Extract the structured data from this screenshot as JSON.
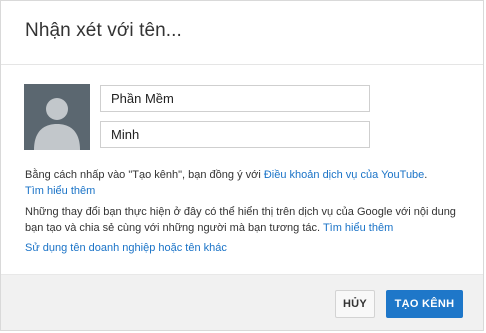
{
  "dialog": {
    "title": "Nhận xét với tên..."
  },
  "form": {
    "first_name": {
      "value": "Phần Mềm"
    },
    "last_name": {
      "value": "Minh"
    }
  },
  "tos": {
    "text": "Bằng cách nhấp vào \"Tạo kênh\", bạn đồng ý với ",
    "terms_link": "Điều khoản dịch vụ của YouTube",
    "period": ".",
    "learn_more": "Tìm hiểu thêm"
  },
  "notice": {
    "text": "Những thay đổi bạn thực hiện ở đây có thể hiển thị trên dịch vụ của Google với nội dung bạn tạo và chia sẻ cùng với những người mà bạn tương tác. ",
    "learn_more": "Tìm hiểu thêm"
  },
  "business_link": "Sử dụng tên doanh nghiệp hoặc tên khác",
  "buttons": {
    "cancel": "HỦY",
    "create": "TẠO KÊNH"
  },
  "icons": {
    "avatar": "default-avatar-icon"
  },
  "colors": {
    "link": "#1a73c7",
    "primary_button": "#1e77c9",
    "avatar_bg": "#5b6770",
    "footer_bg": "#f1f1f1"
  }
}
